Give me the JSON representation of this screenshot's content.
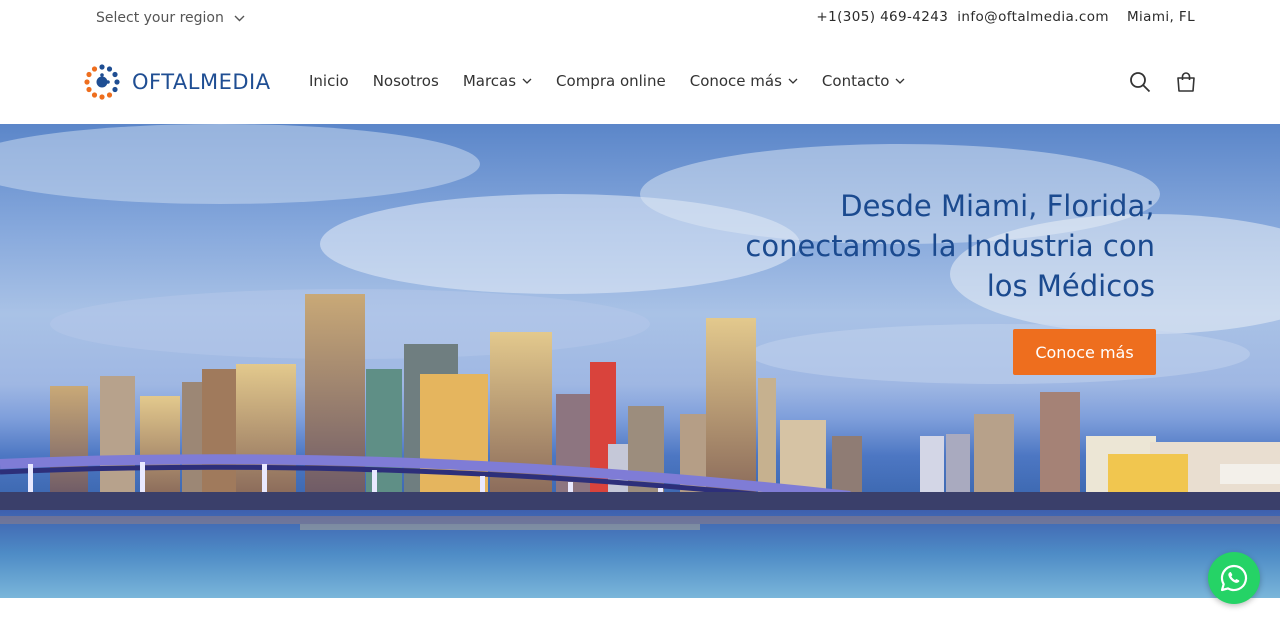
{
  "topbar": {
    "region_label": "Select your region",
    "phone": "+1(305) 469-4243",
    "email": "info@oftalmedia.com",
    "city": "Miami, FL"
  },
  "header": {
    "logo_text": "OFTALMEDIA",
    "nav": [
      {
        "label": "Inicio",
        "has_dropdown": false
      },
      {
        "label": "Nosotros",
        "has_dropdown": false
      },
      {
        "label": "Marcas",
        "has_dropdown": true
      },
      {
        "label": "Compra online",
        "has_dropdown": false
      },
      {
        "label": "Conoce más",
        "has_dropdown": true
      },
      {
        "label": "Contacto",
        "has_dropdown": true
      }
    ],
    "icons": [
      "search-icon",
      "cart-icon"
    ]
  },
  "hero": {
    "headline_line1": "Desde Miami, Florida;",
    "headline_line2": "conectamos la Industria con",
    "headline_line3": "los Médicos",
    "cta_label": "Conoce más"
  },
  "colors": {
    "brand_blue": "#1f4e93",
    "accent_orange": "#ee6e1e",
    "whatsapp_green": "#25d366"
  }
}
